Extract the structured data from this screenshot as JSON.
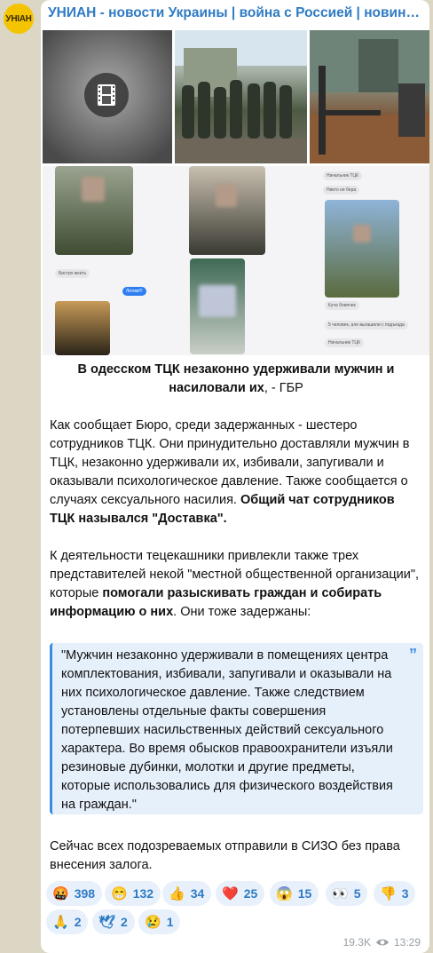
{
  "channel": {
    "avatar_text": "УНІАН",
    "title": "УНИАН - новости Украины | война с Россией | новини України | УНІАН"
  },
  "media": {
    "video_icon": "film-icon",
    "collage_texts": {
      "sender1": "Начальник ТЦК",
      "msg1": "Никто не бера",
      "msg2": "Бистро везіть",
      "msg3": "Летим!!!",
      "msg4": "Куча бовячек",
      "sender2": "Начальник ТЦК",
      "msg5": "5 человек, але выгашили с подъезда",
      "sender3": "Начальник ТЦК",
      "msg6": "Ни на мне везут"
    }
  },
  "post": {
    "caption_bold": "В одесском ТЦК незаконно удерживали мужчин и насиловали их",
    "caption_rest": ", - ГБР",
    "p1_text": "Как сообщает Бюро, среди задержанных - шестеро сотрудников ТЦК. Они принудительно доставляли мужчин в ТЦК, незаконно удерживали их, избивали, запугивали и оказывали психологическое давление. Также сообщается о случаях сексуального насилия. ",
    "p1_bold": "Общий чат сотрудников ТЦК назывался \"Доставка\".",
    "p2_text": "К деятельности тецекашники привлекли также трех представителей некой \"местной общественной организации\", которые ",
    "p2_bold": "помогали разыскивать граждан и собирать информацию о них",
    "p2_end": ". Они тоже задержаны:",
    "quote": "\"Мужчин незаконно удерживали в помещениях центра комплектования, избивали, запугивали и оказывали на них психологическое давление. Также следствием установлены отдельные факты совершения потерпевших насильственных действий сексуального характера. Во время обысков правоохранители изъяли резиновые дубинки, молотки и другие предметы, которые использовались для физического воздействия на граждан.\"",
    "quote_mark": "”",
    "p3": "Сейчас всех подозреваемых отправили в СИЗО без права внесения залога."
  },
  "reactions": [
    {
      "emoji": "🤬",
      "count": "398"
    },
    {
      "emoji": "😁",
      "count": "132"
    },
    {
      "emoji": "👍",
      "count": "34"
    },
    {
      "emoji": "❤️",
      "count": "25"
    },
    {
      "emoji": "😱",
      "count": "15"
    },
    {
      "emoji": "👀",
      "count": "5"
    },
    {
      "emoji": "👎",
      "count": "3"
    },
    {
      "emoji": "🙏",
      "count": "2"
    },
    {
      "emoji": "🕊",
      "count": "2"
    },
    {
      "emoji": "😢",
      "count": "1"
    }
  ],
  "meta": {
    "views": "19.3K",
    "views_icon": "eye-icon",
    "time": "13:29"
  }
}
